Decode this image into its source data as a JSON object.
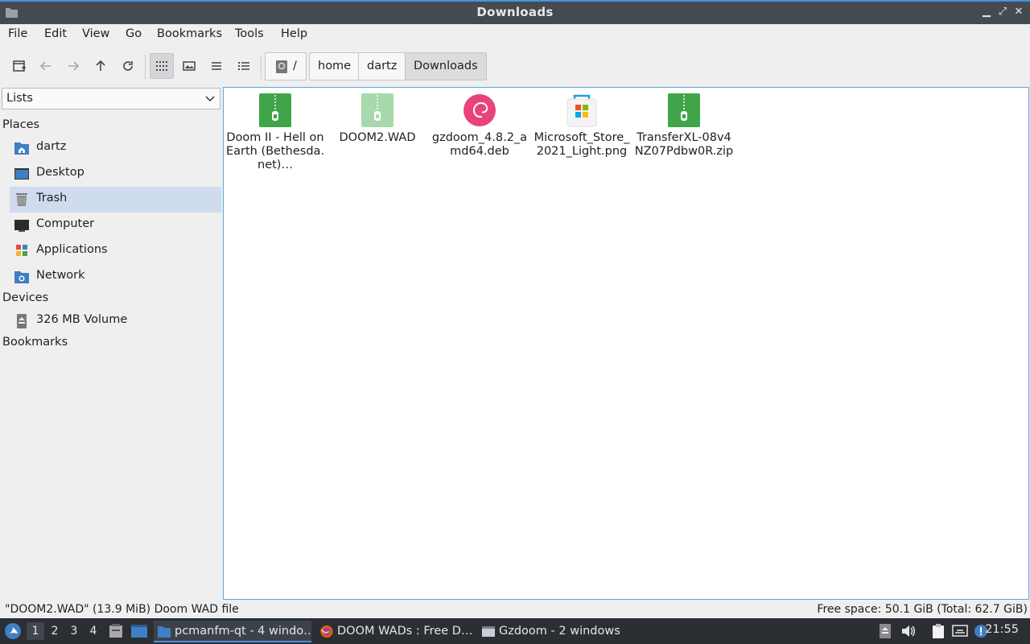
{
  "window": {
    "title": "Downloads"
  },
  "menu": [
    "File",
    "Edit",
    "View",
    "Go",
    "Bookmarks",
    "Tools",
    "Help"
  ],
  "toolbar": {
    "icons": [
      "new-tab-icon",
      "back-icon",
      "forward-icon",
      "up-icon",
      "reload-icon",
      "icon-view-icon",
      "thumbnail-view-icon",
      "compact-view-icon",
      "detailed-list-icon"
    ],
    "breadcrumb": [
      "/",
      "home",
      "dartz",
      "Downloads"
    ]
  },
  "sidebar": {
    "mode": "Lists",
    "places_header": "Places",
    "places": [
      {
        "label": "dartz",
        "icon": "home-folder-icon"
      },
      {
        "label": "Desktop",
        "icon": "desktop-icon"
      },
      {
        "label": "Trash",
        "icon": "trash-icon",
        "selected": true
      },
      {
        "label": "Computer",
        "icon": "computer-icon"
      },
      {
        "label": "Applications",
        "icon": "applications-icon"
      },
      {
        "label": "Network",
        "icon": "network-icon"
      }
    ],
    "devices_header": "Devices",
    "devices": [
      {
        "label": "326 MB Volume",
        "icon": "drive-icon"
      }
    ],
    "bookmarks_header": "Bookmarks"
  },
  "files": [
    {
      "name": "Doom II - Hell on Earth (Bethesda.net)…",
      "icon": "archive-icon"
    },
    {
      "name": "DOOM2.WAD",
      "icon": "archive-icon",
      "selected": true
    },
    {
      "name": "gzdoom_4.8.2_amd64.deb",
      "icon": "debian-package-icon"
    },
    {
      "name": "Microsoft_Store_2021_Light.png",
      "icon": "microsoft-store-icon"
    },
    {
      "name": "TransferXL-08v4NZ07Pdbw0R.zip",
      "icon": "archive-icon"
    }
  ],
  "status": {
    "selection": "\"DOOM2.WAD\" (13.9 MiB) Doom WAD file",
    "free_space": "Free space: 50.1 GiB (Total: 62.7 GiB)"
  },
  "taskbar": {
    "desktops": [
      "1",
      "2",
      "3",
      "4"
    ],
    "tasks": [
      {
        "label": "pcmanfm-qt - 4 windo…",
        "icon": "folder-icon",
        "active": true
      },
      {
        "label": "DOOM WADs : Free D…",
        "icon": "firefox-icon"
      },
      {
        "label": "Gzdoom - 2 windows",
        "icon": "window-icon"
      }
    ],
    "clock": "21:55"
  },
  "colors": {
    "accent": "#4a90d9",
    "selection": "#3d7fcf",
    "archive_green": "#3fa548",
    "debian_pink": "#e9437a"
  }
}
